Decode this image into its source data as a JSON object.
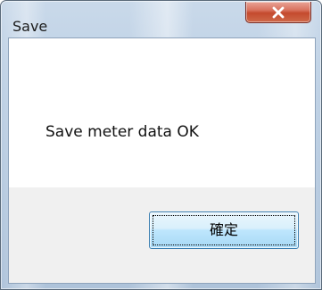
{
  "window": {
    "title": "Save",
    "close_icon": "close-x-icon"
  },
  "dialog": {
    "message": "Save meter data OK",
    "ok_label": "確定"
  },
  "colors": {
    "frame": "#bdd0e4",
    "close_button": "#c44a2e",
    "button_strip": "#f0f0f0",
    "ok_button_border": "#3c7fb1"
  }
}
